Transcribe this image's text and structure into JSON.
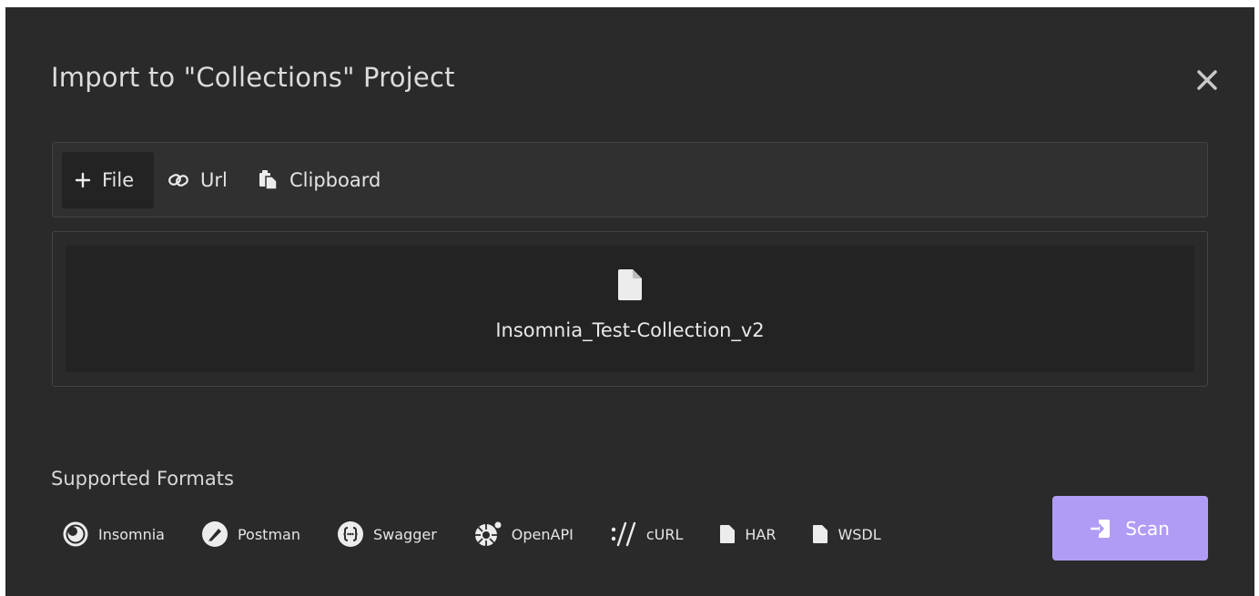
{
  "modal": {
    "title": "Import to \"Collections\" Project"
  },
  "tabs": [
    {
      "label": "File",
      "icon": "plus-icon",
      "active": true
    },
    {
      "label": "Url",
      "icon": "link-icon",
      "active": false
    },
    {
      "label": "Clipboard",
      "icon": "clipboard-icon",
      "active": false
    }
  ],
  "dropzone": {
    "file_name": "Insomnia_Test-Collection_v2",
    "icon": "file-icon"
  },
  "formats": {
    "title": "Supported Formats",
    "items": [
      {
        "label": "Insomnia",
        "icon": "insomnia-icon"
      },
      {
        "label": "Postman",
        "icon": "postman-icon"
      },
      {
        "label": "Swagger",
        "icon": "swagger-icon"
      },
      {
        "label": "OpenAPI",
        "icon": "openapi-icon"
      },
      {
        "label": "cURL",
        "icon": "curl-icon"
      },
      {
        "label": "HAR",
        "icon": "file-icon"
      },
      {
        "label": "WSDL",
        "icon": "file-icon"
      }
    ]
  },
  "actions": {
    "scan_label": "Scan"
  },
  "colors": {
    "background": "#2a2a2a",
    "accent": "#b19cf5"
  }
}
